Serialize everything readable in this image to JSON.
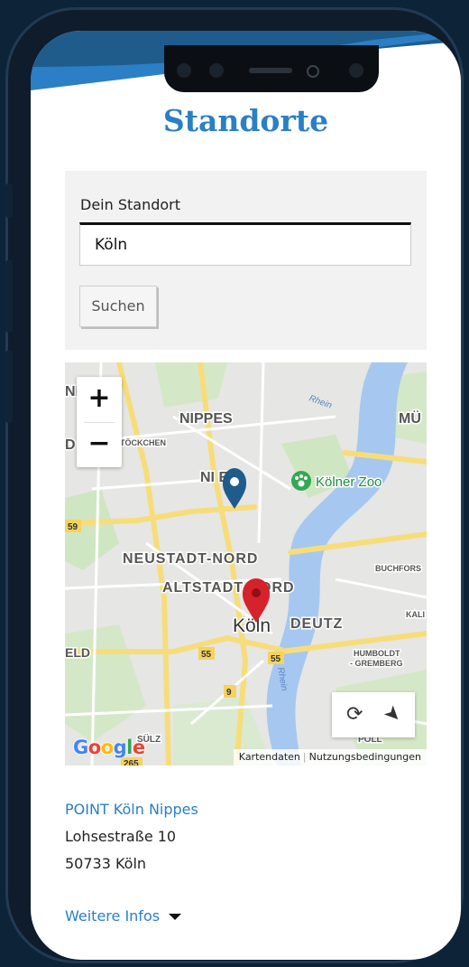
{
  "page": {
    "title": "Standorte"
  },
  "search": {
    "label": "Dein Standort",
    "value": "Köln",
    "button_label": "Suchen"
  },
  "map": {
    "zoom_in": "+",
    "zoom_out": "−",
    "attribution_data": "Kartendaten",
    "attribution_terms": "Nutzungsbedingungen",
    "google": "Google",
    "labels": {
      "nippes": "NIPPES",
      "nippes2": "NI  ES",
      "mu": "MÜ",
      "d": "D",
      "nw": "NI",
      "derstockchen": "DERSTÖCKCHEN",
      "zoo": "Kölner Zoo",
      "rhein1": "Rhein",
      "rhein2": "Rhein",
      "neustadt": "NEUSTADT-NORD",
      "altstadt": "ALTSTADT-NORD",
      "buchfors": "BUCHFORS",
      "koln": "Köln",
      "deutz": "DEUTZ",
      "kal": "KALI",
      "eld": "ELD",
      "humboldt1": "HUMBOLDT",
      "humboldt2": "- GREMBERG",
      "sulz": "SÜLZ",
      "poll": "POLL",
      "r59": "59",
      "r55a": "55",
      "r55b": "55",
      "r9": "9",
      "r265": "265"
    },
    "marker_blue_color": "#1f5c8c",
    "marker_red_color": "#d6222a"
  },
  "location": {
    "name": "POINT Köln Nippes",
    "street": "Lohsestraße 10",
    "city": "50733 Köln",
    "more_label": "Weitere Infos"
  }
}
